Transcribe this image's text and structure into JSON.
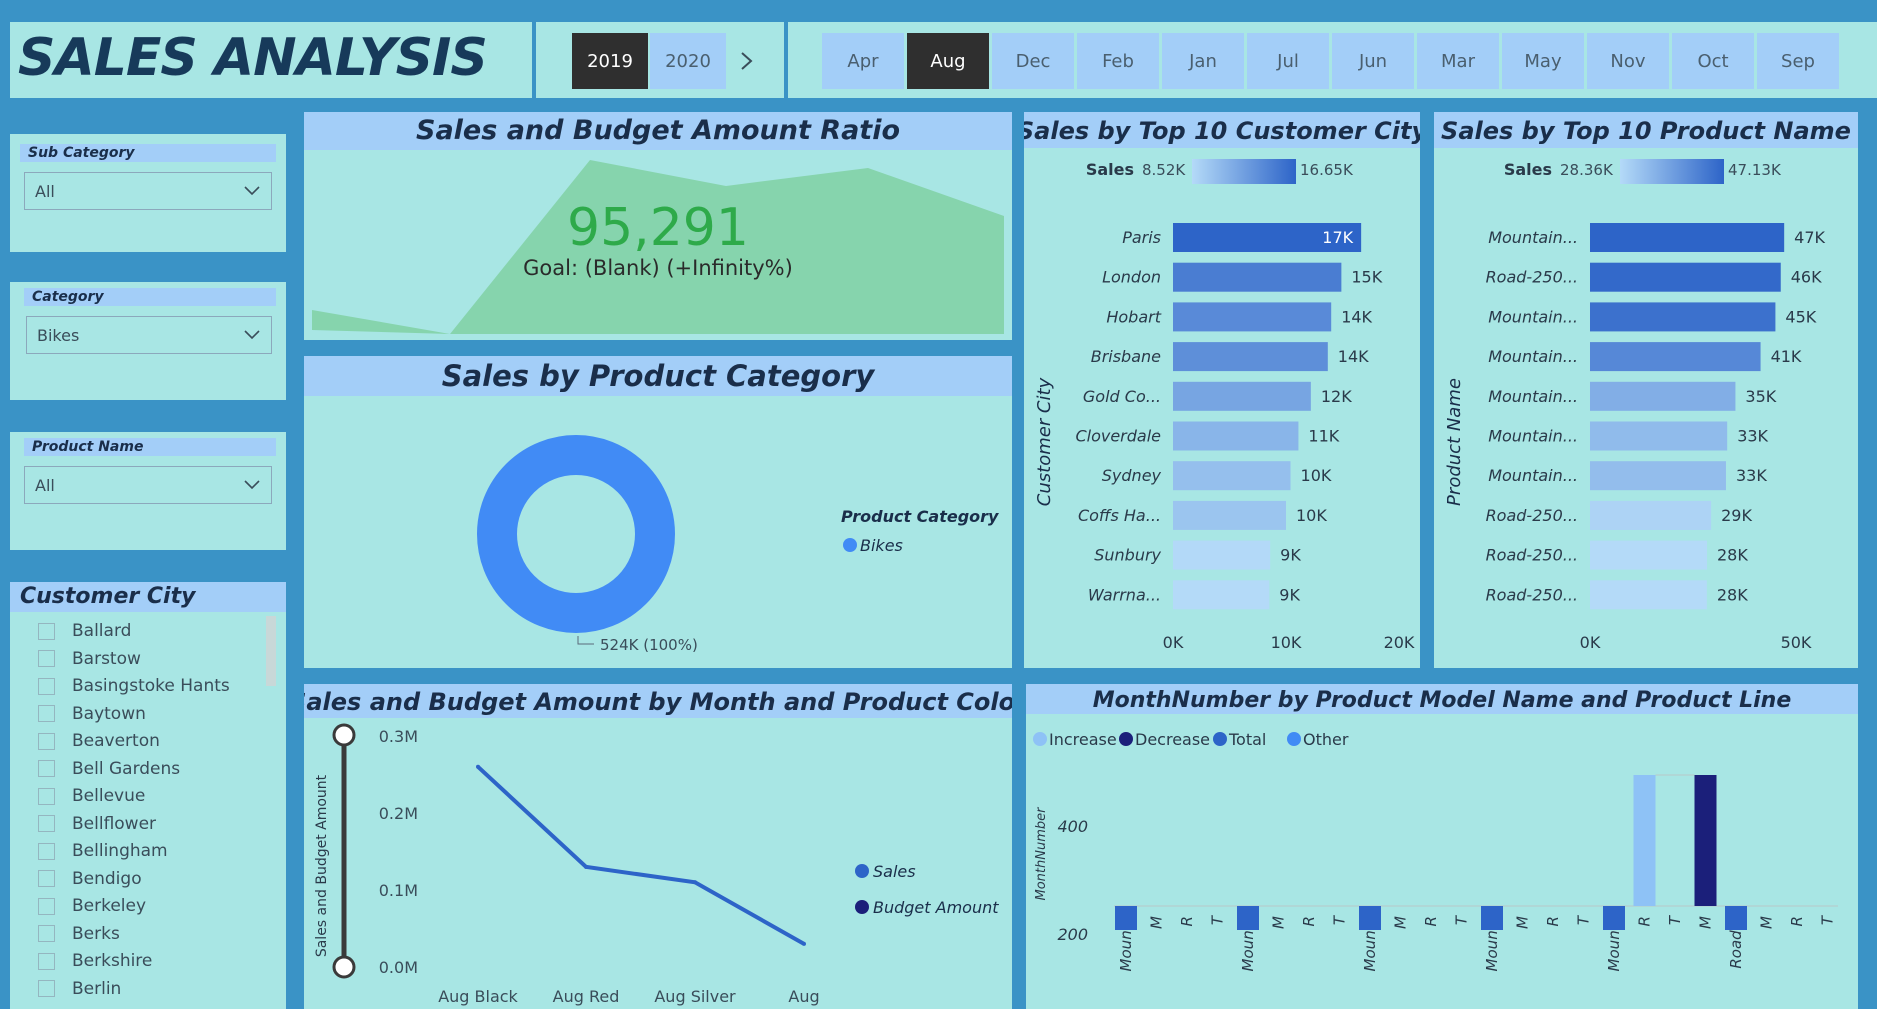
{
  "header": {
    "title": "SALES ANALYSIS",
    "years": [
      {
        "label": "2019",
        "selected": true
      },
      {
        "label": "2020",
        "selected": false
      }
    ],
    "months": [
      {
        "label": "Apr",
        "selected": false
      },
      {
        "label": "Aug",
        "selected": true
      },
      {
        "label": "Dec",
        "selected": false
      },
      {
        "label": "Feb",
        "selected": false
      },
      {
        "label": "Jan",
        "selected": false
      },
      {
        "label": "Jul",
        "selected": false
      },
      {
        "label": "Jun",
        "selected": false
      },
      {
        "label": "Mar",
        "selected": false
      },
      {
        "label": "May",
        "selected": false
      },
      {
        "label": "Nov",
        "selected": false
      },
      {
        "label": "Oct",
        "selected": false
      },
      {
        "label": "Sep",
        "selected": false
      }
    ]
  },
  "filters": {
    "sub_category": {
      "label": "Sub Category",
      "value": "All"
    },
    "category": {
      "label": "Category",
      "value": "Bikes"
    },
    "product_name": {
      "label": "Product Name",
      "value": "All"
    }
  },
  "customer_city": {
    "title": "Customer City",
    "items": [
      "Ballard",
      "Barstow",
      "Basingstoke Hants",
      "Baytown",
      "Beaverton",
      "Bell Gardens",
      "Bellevue",
      "Bellflower",
      "Bellingham",
      "Bendigo",
      "Berkeley",
      "Berks",
      "Berkshire",
      "Berlin"
    ]
  },
  "kpi": {
    "title": "Sales and Budget Amount Ratio",
    "value": "95,291",
    "goal": "Goal: (Blank) (+Infinity%)"
  },
  "donut": {
    "title": "Sales by Product Category",
    "legend_title": "Product Category",
    "legend_items": [
      {
        "name": "Bikes",
        "color": "#418bf5"
      }
    ],
    "data_label": "524K (100%)"
  },
  "colors": {
    "accent_blue": "#418bf5",
    "kpi_green": "#2eaa4a",
    "dark_navy": "#1b1f7a",
    "panel_bg": "#a8e6e4",
    "title_bg": "#a3cef8"
  },
  "chart_data": [
    {
      "type": "bar",
      "title": "Sales by Top 10 Customer City",
      "ylabel": "Customer City",
      "legend_label": "Sales",
      "legend_min": "8.52K",
      "legend_max": "16.65K",
      "categories": [
        "Paris",
        "London",
        "Hobart",
        "Brisbane",
        "Gold Co...",
        "Cloverdale",
        "Sydney",
        "Coffs Ha...",
        "Sunbury",
        "Warrna..."
      ],
      "values": [
        16.65,
        14.9,
        14.0,
        13.7,
        12.2,
        11.1,
        10.4,
        10.0,
        8.6,
        8.52
      ],
      "data_labels": [
        "17K",
        "15K",
        "14K",
        "14K",
        "12K",
        "11K",
        "10K",
        "10K",
        "9K",
        "9K"
      ],
      "xlim": [
        0,
        20
      ],
      "xticks": [
        "0K",
        "10K",
        "20K"
      ]
    },
    {
      "type": "bar",
      "title": "Sales by Top 10 Product Name",
      "ylabel": "Product Name",
      "legend_label": "Sales",
      "legend_min": "28.36K",
      "legend_max": "47.13K",
      "categories": [
        "Mountain...",
        "Road-250...",
        "Mountain...",
        "Mountain...",
        "Mountain...",
        "Mountain...",
        "Mountain...",
        "Road-250...",
        "Road-250...",
        "Road-250..."
      ],
      "values": [
        47.13,
        46.3,
        45.0,
        41.4,
        35.3,
        33.3,
        33.0,
        29.4,
        28.4,
        28.36
      ],
      "data_labels": [
        "47K",
        "46K",
        "45K",
        "41K",
        "35K",
        "33K",
        "33K",
        "29K",
        "28K",
        "28K"
      ],
      "xlim": [
        0,
        50
      ],
      "xticks": [
        "0K",
        "50K"
      ]
    },
    {
      "type": "line",
      "title": "Sales and Budget Amount by Month and Product Color",
      "ylabel": "Sales and Budget Amount",
      "categories": [
        "Aug Black",
        "Aug Red",
        "Aug Silver",
        "Aug"
      ],
      "series": [
        {
          "name": "Sales",
          "values": [
            0.26,
            0.13,
            0.11,
            0.03
          ],
          "color": "#2d64c8"
        },
        {
          "name": "Budget Amount",
          "values": [],
          "color": "#1b1f7a"
        }
      ],
      "ylim": [
        0,
        0.3
      ],
      "yticks": [
        "0.0M",
        "0.1M",
        "0.2M",
        "0.3M"
      ]
    },
    {
      "type": "bar",
      "title": "MonthNumber by Product Model Name and Product Line",
      "ylabel": "MonthNumber",
      "legend": [
        {
          "name": "Increase",
          "color": "#8ec2f6"
        },
        {
          "name": "Decrease",
          "color": "#1b1f7a"
        },
        {
          "name": "Total",
          "color": "#2d64c8"
        },
        {
          "name": "Other",
          "color": "#418bf5"
        }
      ],
      "categories": [
        "Moun...",
        "M",
        "R",
        "T",
        "Moun...",
        "M",
        "R",
        "T",
        "Moun...",
        "M",
        "R",
        "T",
        "Moun...",
        "M",
        "R",
        "T",
        "Moun...",
        "R",
        "T",
        "M",
        "Road...",
        "M",
        "R",
        "T"
      ],
      "yticks": [
        "200",
        "400"
      ]
    }
  ]
}
